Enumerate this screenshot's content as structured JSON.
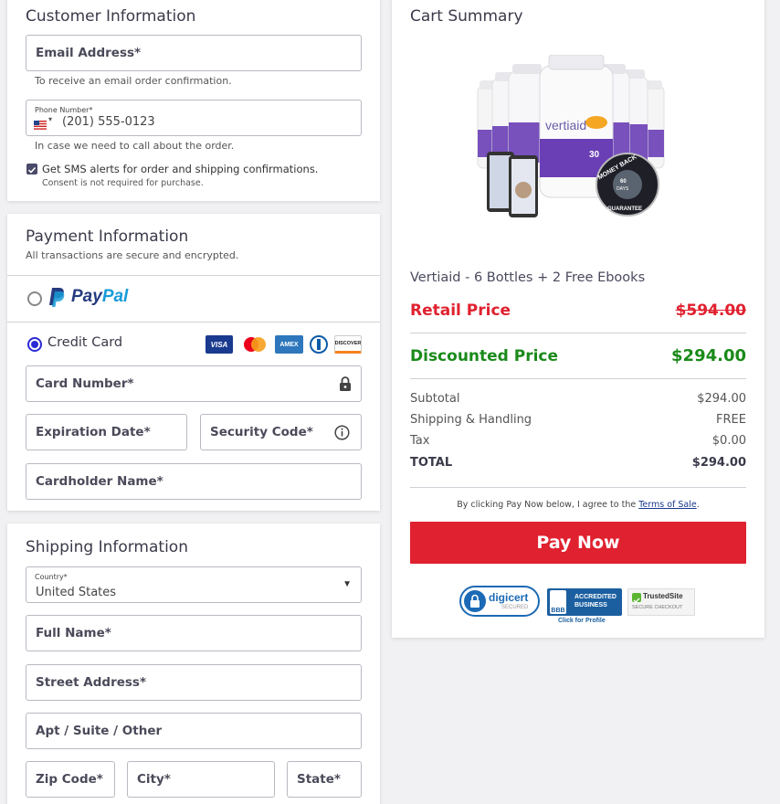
{
  "customer": {
    "title": "Customer Information",
    "email_label": "Email Address*",
    "email_hint": "To receive an email order confirmation.",
    "phone_label": "Phone Number*",
    "phone_value": "(201) 555-0123",
    "phone_country": "🇺🇸 ▾",
    "phone_hint": "In case we need to call about the order.",
    "sms_label": "Get SMS alerts for order and shipping confirmations.",
    "sms_consent": "Consent is not required for purchase."
  },
  "payment": {
    "title": "Payment Information",
    "subtitle": "All transactions are secure and encrypted.",
    "paypal_pay": "Pay",
    "paypal_pal": "Pal",
    "credit_card_label": "Credit Card",
    "card_logos": [
      "VISA",
      "MC",
      "AMEX",
      "DINERS",
      "DISCOVER"
    ],
    "card_number_label": "Card Number*",
    "expiration_label": "Expiration Date*",
    "security_label": "Security Code*",
    "cardholder_label": "Cardholder Name*"
  },
  "shipping": {
    "title": "Shipping Information",
    "country_label": "Country*",
    "country_value": "United States",
    "full_name_label": "Full Name*",
    "street_label": "Street Address*",
    "apt_label": "Apt / Suite / Other",
    "zip_label": "Zip Code*",
    "city_label": "City*",
    "state_label": "State*"
  },
  "cart": {
    "title": "Cart Summary",
    "product_name": "Vertiaid - 6 Bottles + 2 Free Ebooks",
    "product_image_labels": {
      "brand": "vertiaid",
      "count": "30",
      "seal_top": "MONEY BACK",
      "seal_days": "60 DAYS",
      "seal_bottom": "GUARANTEE"
    },
    "retail_label": "Retail Price",
    "retail_price": "$594.00",
    "discounted_label": "Discounted Price",
    "discounted_price": "$294.00",
    "subtotal_label": "Subtotal",
    "subtotal_value": "$294.00",
    "shipping_label": "Shipping & Handling",
    "shipping_value": "FREE",
    "tax_label": "Tax",
    "tax_value": "$0.00",
    "total_label": "TOTAL",
    "total_value": "$294.00",
    "terms_prefix": "By clicking Pay Now below, I agree to the ",
    "terms_link": "Terms of Sale",
    "terms_suffix": ".",
    "pay_button": "Pay Now",
    "badges": {
      "digicert": "digicert",
      "digicert_sub": "SECURED",
      "bbb_line1": "ACCREDITED",
      "bbb_line2": "BUSINESS",
      "bbb_logo": "BBB",
      "bbb_profile": "Click for Profile",
      "trusted_name": "TrustedSite",
      "trusted_sub": "SECURE CHECKOUT"
    }
  },
  "colors": {
    "accent_red": "#e0212f",
    "retail_red": "#e0212f",
    "discount_green": "#1a8a1a",
    "radio_blue": "#2b2bd6",
    "paypal_dark": "#253b80",
    "paypal_light": "#179bd7"
  }
}
